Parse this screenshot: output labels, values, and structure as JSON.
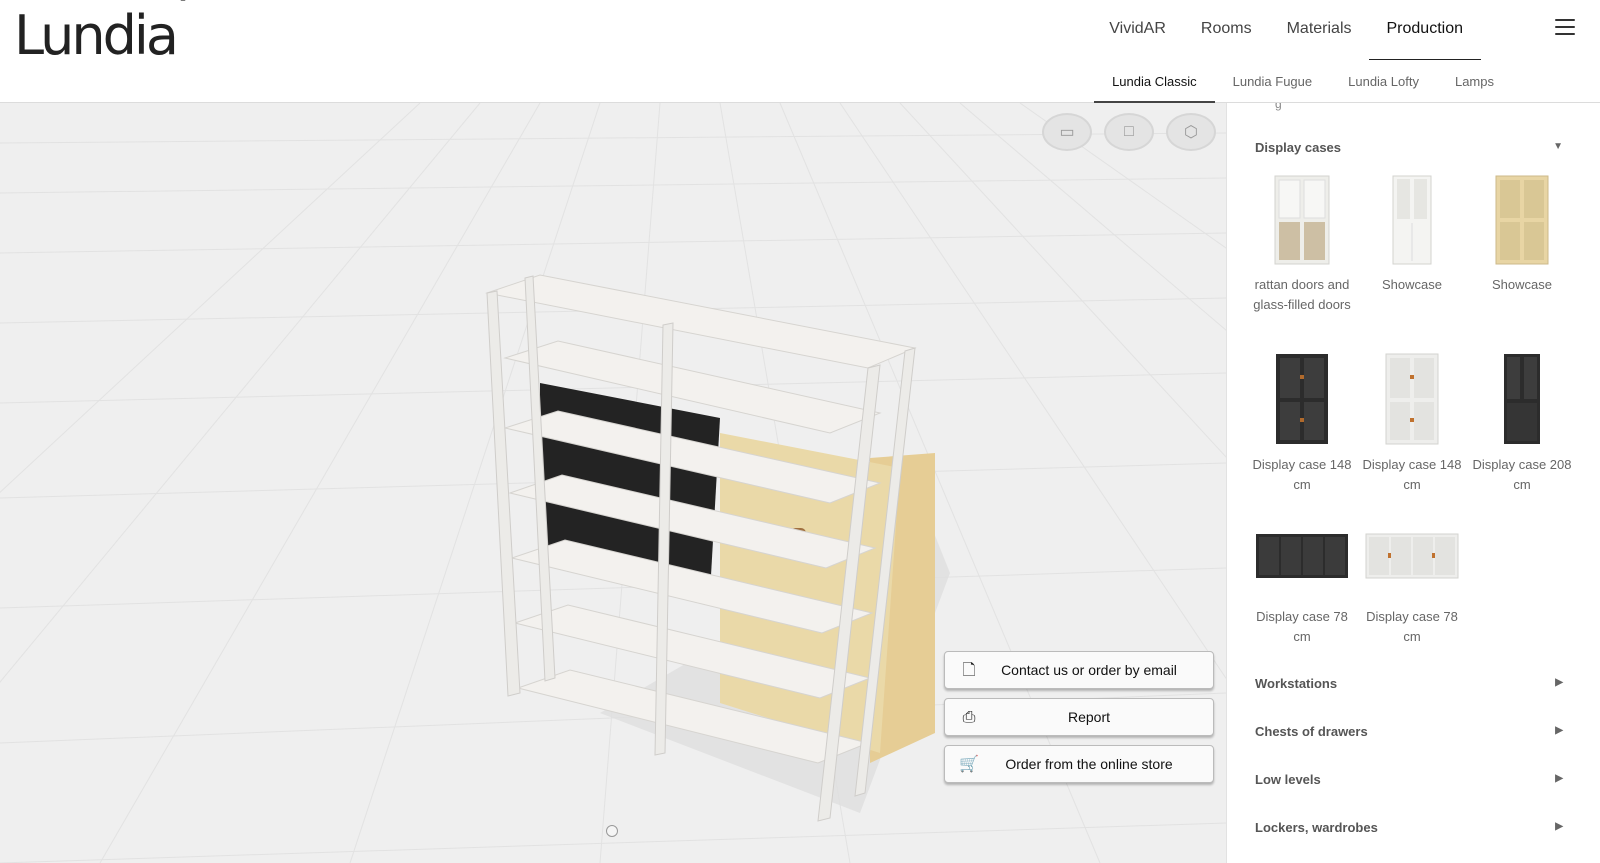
{
  "header": {
    "logo": "Lundia",
    "main_nav": [
      "VividAR",
      "Rooms",
      "Materials",
      "Production"
    ],
    "active_main": "Production",
    "sub_nav": [
      "Lundia Classic",
      "Lundia Fugue",
      "Lundia Lofty",
      "Lamps"
    ],
    "active_sub": "Lundia Classic"
  },
  "viewer": {
    "view_icons": [
      "front-view-icon",
      "side-view-icon",
      "3d-view-icon"
    ],
    "actions": {
      "contact_label": "Contact us or order by email",
      "report_label": "Report",
      "order_label": "Order from the online store"
    }
  },
  "panel": {
    "partial_text": "g",
    "display_cases": {
      "title": "Display cases",
      "items": [
        {
          "caption": "rattan doors and glass-filled doors",
          "finish": "white-rattan"
        },
        {
          "caption": "Showcase",
          "finish": "white-glass"
        },
        {
          "caption": "Showcase",
          "finish": "oak-rattan"
        },
        {
          "caption": "Display case 148 cm",
          "finish": "black"
        },
        {
          "caption": "Display case 148 cm",
          "finish": "white"
        },
        {
          "caption": "Display case 208 cm",
          "finish": "black-tall"
        },
        {
          "caption": "Display case 78 cm",
          "finish": "black-low"
        },
        {
          "caption": "Display case 78 cm",
          "finish": "white-low"
        }
      ]
    },
    "categories": [
      "Workstations",
      "Chests of drawers",
      "Low levels",
      "Lockers, wardrobes"
    ]
  },
  "colors": {
    "accent": "#222222",
    "oak": "#e8d5a4",
    "black": "#2c2c2c",
    "white": "#eeeeec"
  }
}
